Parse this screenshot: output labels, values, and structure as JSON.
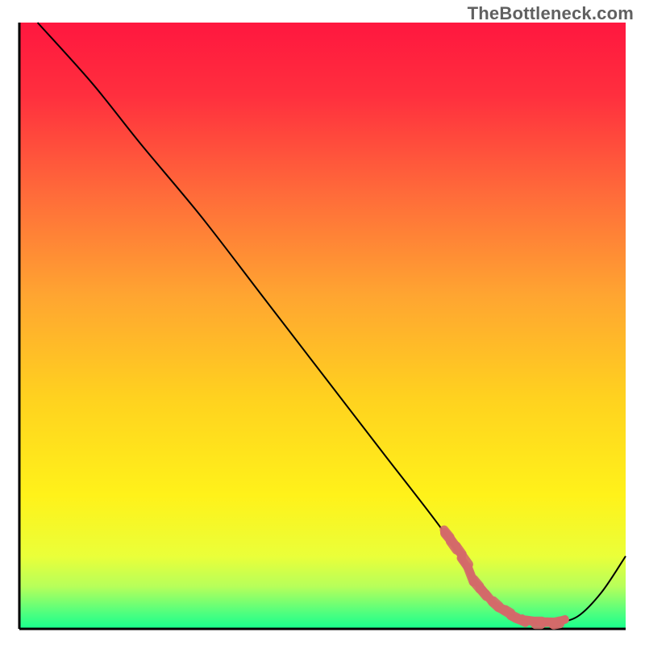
{
  "attribution": "TheBottleneck.com",
  "chart_data": {
    "type": "line",
    "title": "",
    "xlabel": "",
    "ylabel": "",
    "xlim": [
      0,
      100
    ],
    "ylim": [
      0,
      100
    ],
    "grid": false,
    "series": [
      {
        "name": "curve",
        "x": [
          3,
          12,
          20,
          30,
          40,
          50,
          60,
          70,
          75,
          80,
          85,
          88,
          92,
          96,
          100
        ],
        "y": [
          100,
          90,
          80,
          68,
          55,
          42,
          29,
          16,
          8,
          3,
          1,
          1,
          2,
          6,
          12
        ]
      },
      {
        "name": "highlight",
        "x": [
          70,
          71,
          72,
          73,
          74,
          75,
          76,
          77,
          78,
          79,
          80,
          81,
          82,
          83,
          83.5,
          85,
          86,
          87,
          88,
          89,
          90
        ],
        "y": [
          16,
          14.8,
          13.4,
          12,
          10.6,
          8,
          6.8,
          5.6,
          4.4,
          3.5,
          3,
          2.4,
          1.9,
          1.5,
          1.2,
          1,
          1,
          1,
          1,
          1.2,
          1.5
        ]
      }
    ],
    "background_gradient": {
      "stops": [
        {
          "offset": 0.0,
          "color": "#ff173f"
        },
        {
          "offset": 0.12,
          "color": "#ff2f3e"
        },
        {
          "offset": 0.28,
          "color": "#ff6a3a"
        },
        {
          "offset": 0.45,
          "color": "#ffa531"
        },
        {
          "offset": 0.62,
          "color": "#ffd21f"
        },
        {
          "offset": 0.78,
          "color": "#fff21a"
        },
        {
          "offset": 0.88,
          "color": "#eaff39"
        },
        {
          "offset": 0.93,
          "color": "#b7ff5a"
        },
        {
          "offset": 0.975,
          "color": "#4cff80"
        },
        {
          "offset": 1.0,
          "color": "#17ff8d"
        }
      ]
    },
    "axis_color": "#000000",
    "curve_color": "#000000",
    "highlight_color": "#d46a6a"
  }
}
